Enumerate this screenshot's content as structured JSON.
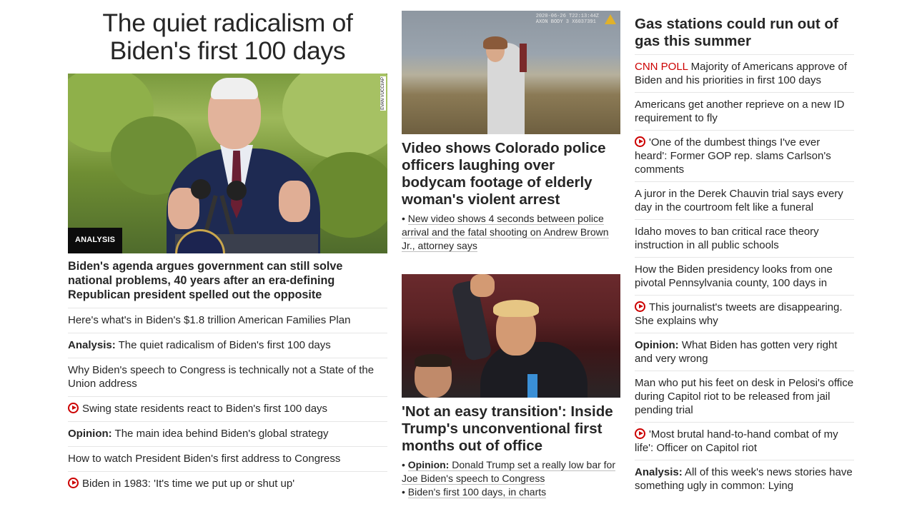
{
  "left": {
    "headline": "The quiet radicalism of Biden's first 100 days",
    "photo_credit": "EVAN VUCCI/AP",
    "badge": "ANALYSIS",
    "lead": "Biden's agenda argues government can still solve national problems, 40 years after an era-defining Republican president spelled out the opposite",
    "items": [
      {
        "prefix": "",
        "text": "Here's what's in Biden's $1.8 trillion American Families Plan",
        "video": false
      },
      {
        "prefix": "Analysis:",
        "text": " The quiet radicalism of Biden's first 100 days",
        "video": false
      },
      {
        "prefix": "",
        "text": "Why Biden's speech to Congress is technically not a State of the Union address",
        "video": false
      },
      {
        "prefix": "",
        "text": "Swing state residents react to Biden's first 100 days",
        "video": true
      },
      {
        "prefix": "Opinion:",
        "text": " The main idea behind Biden's global strategy",
        "video": false
      },
      {
        "prefix": "",
        "text": "How to watch President Biden's first address to Congress",
        "video": false
      },
      {
        "prefix": "",
        "text": "Biden in 1983: 'It's time we put up or shut up'",
        "video": true
      }
    ]
  },
  "middle": {
    "story1": {
      "timestamp_line1": "2020-06-26 T22:13:44Z",
      "timestamp_line2": "AXON BODY 3 X6037391",
      "title": "Video shows Colorado police officers laughing over bodycam footage of elderly woman's violent arrest",
      "bullet": "New video shows 4 seconds between police arrival and the fatal shooting on Andrew Brown Jr., attorney says"
    },
    "story2": {
      "title": "'Not an easy transition': Inside Trump's unconventional first months out of office",
      "bullet1_prefix": "Opinion:",
      "bullet1_text": " Donald Trump set a really low bar for Joe Biden's speech to Congress",
      "bullet2": "Biden's first 100 days, in charts"
    }
  },
  "right": {
    "title": "Gas stations could run out of gas this summer",
    "items": [
      {
        "prefix": "",
        "red": "CNN POLL",
        "text": " Majority of Americans approve of Biden and his priorities in first 100 days",
        "video": false
      },
      {
        "prefix": "",
        "red": "",
        "text": "Americans get another reprieve on a new ID requirement to fly",
        "video": false
      },
      {
        "prefix": "",
        "red": "",
        "text": "'One of the dumbest things I've ever heard': Former GOP rep. slams Carlson's comments",
        "video": true
      },
      {
        "prefix": "",
        "red": "",
        "text": "A juror in the Derek Chauvin trial says every day in the courtroom felt like a funeral",
        "video": false
      },
      {
        "prefix": "",
        "red": "",
        "text": "Idaho moves to ban critical race theory instruction in all public schools",
        "video": false
      },
      {
        "prefix": "",
        "red": "",
        "text": "How the Biden presidency looks from one pivotal Pennsylvania county, 100 days in",
        "video": false
      },
      {
        "prefix": "",
        "red": "",
        "text": "This journalist's tweets are disappearing. She explains why",
        "video": true
      },
      {
        "prefix": "Opinion:",
        "red": "",
        "text": " What Biden has gotten very right and very wrong",
        "video": false
      },
      {
        "prefix": "",
        "red": "",
        "text": "Man who put his feet on desk in Pelosi's office during Capitol riot to be released from jail pending trial",
        "video": false
      },
      {
        "prefix": "",
        "red": "",
        "text": "'Most brutal hand-to-hand combat of my life': Officer on Capitol riot",
        "video": true
      },
      {
        "prefix": "Analysis:",
        "red": "",
        "text": " All of this week's news stories have something ugly in common: Lying",
        "video": false
      }
    ]
  }
}
